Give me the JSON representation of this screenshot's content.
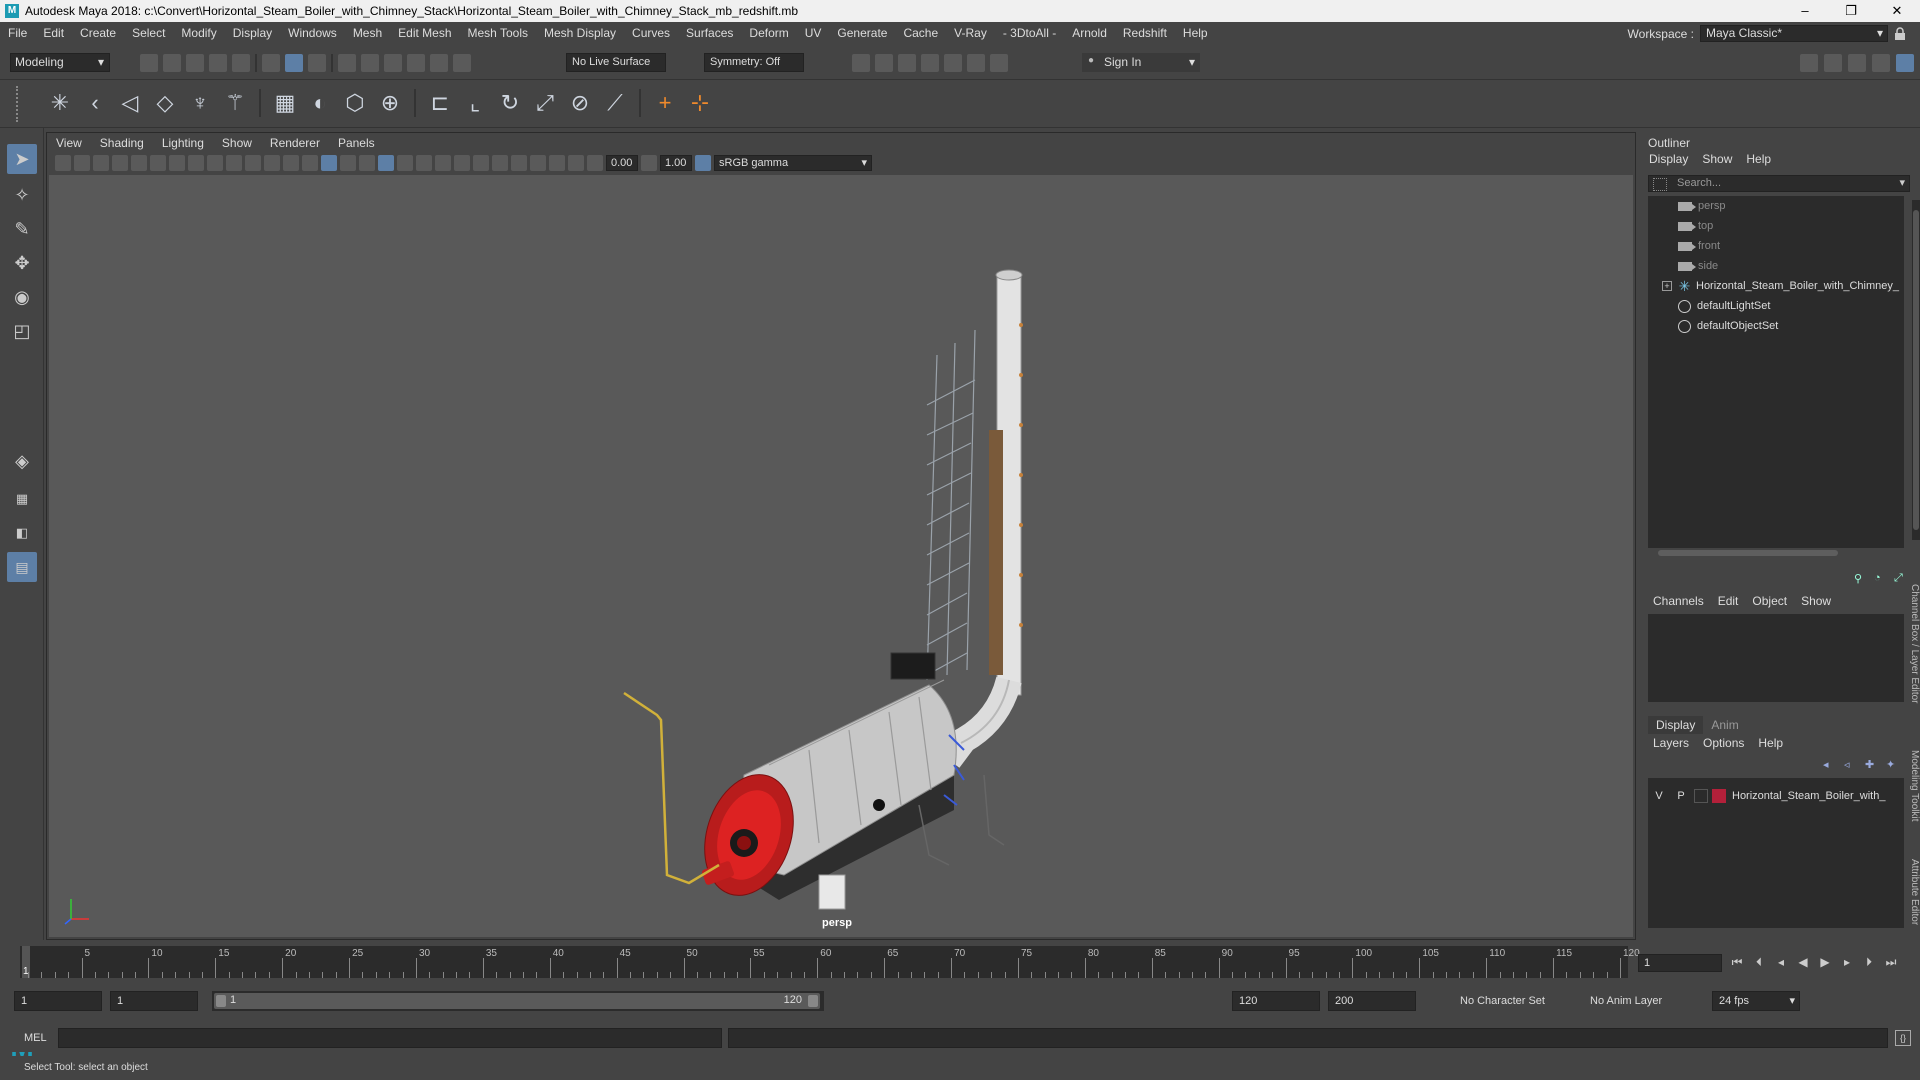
{
  "window": {
    "title": "Autodesk Maya 2018: c:\\Convert\\Horizontal_Steam_Boiler_with_Chimney_Stack\\Horizontal_Steam_Boiler_with_Chimney_Stack_mb_redshift.mb",
    "logo": "M",
    "minimize": "–",
    "maximize": "❐",
    "close": "✕"
  },
  "menubar": {
    "items": [
      "File",
      "Edit",
      "Create",
      "Select",
      "Modify",
      "Display",
      "Windows",
      "Mesh",
      "Edit Mesh",
      "Mesh Tools",
      "Mesh Display",
      "Curves",
      "Surfaces",
      "Deform",
      "UV",
      "Generate",
      "Cache",
      "V-Ray",
      "- 3DtoAll -",
      "Arnold",
      "Redshift",
      "Help"
    ]
  },
  "workspace": {
    "label": "Workspace :",
    "value": "Maya Classic*"
  },
  "statusline": {
    "mode": "Modeling",
    "live_surface": "No Live Surface",
    "symmetry": "Symmetry: Off",
    "sign_in": "Sign In"
  },
  "viewport": {
    "menu": [
      "View",
      "Shading",
      "Lighting",
      "Show",
      "Renderer",
      "Panels"
    ],
    "exposure": "0.00",
    "gamma": "1.00",
    "color_space": "sRGB gamma",
    "camera": "persp"
  },
  "outliner": {
    "title": "Outliner",
    "menu": [
      "Display",
      "Show",
      "Help"
    ],
    "search_placeholder": "Search...",
    "items": [
      {
        "label": "persp",
        "icon": "camera-icon",
        "dim": true
      },
      {
        "label": "top",
        "icon": "camera-icon",
        "dim": true
      },
      {
        "label": "front",
        "icon": "camera-icon",
        "dim": true
      },
      {
        "label": "side",
        "icon": "camera-icon",
        "dim": true
      },
      {
        "label": "Horizontal_Steam_Boiler_with_Chimney_",
        "icon": "group-icon",
        "dim": false
      },
      {
        "label": "defaultLightSet",
        "icon": "set-icon",
        "dim": false
      },
      {
        "label": "defaultObjectSet",
        "icon": "set-icon",
        "dim": false
      }
    ]
  },
  "channelbox": {
    "menu": [
      "Channels",
      "Edit",
      "Object",
      "Show"
    ]
  },
  "layer_editor": {
    "tabs": [
      "Display",
      "Anim"
    ],
    "menu": [
      "Layers",
      "Options",
      "Help"
    ],
    "layer": {
      "v": "V",
      "p": "P",
      "name": "Horizontal_Steam_Boiler_with_",
      "color": "#b3203a"
    }
  },
  "side_tabs": [
    "Channel Box / Layer Editor",
    "Modeling Toolkit",
    "Attribute Editor"
  ],
  "timeslider": {
    "start": 1,
    "end": 120,
    "labels": [
      5,
      10,
      15,
      20,
      25,
      30,
      35,
      40,
      45,
      50,
      55,
      60,
      65,
      70,
      75,
      80,
      85,
      90,
      95,
      100,
      105,
      110,
      115,
      120
    ],
    "current_label": "1",
    "current_frame": "1"
  },
  "rangeslider": {
    "anim_start": "1",
    "playback_start": "1",
    "range_start_label": "1",
    "range_end_label": "120",
    "playback_end": "120",
    "anim_end": "200",
    "character_set": "No Character Set",
    "anim_layer": "No Anim Layer",
    "fps": "24 fps"
  },
  "cmdline": {
    "label": "MEL"
  },
  "helpline": {
    "text": "Select Tool: select an object"
  }
}
